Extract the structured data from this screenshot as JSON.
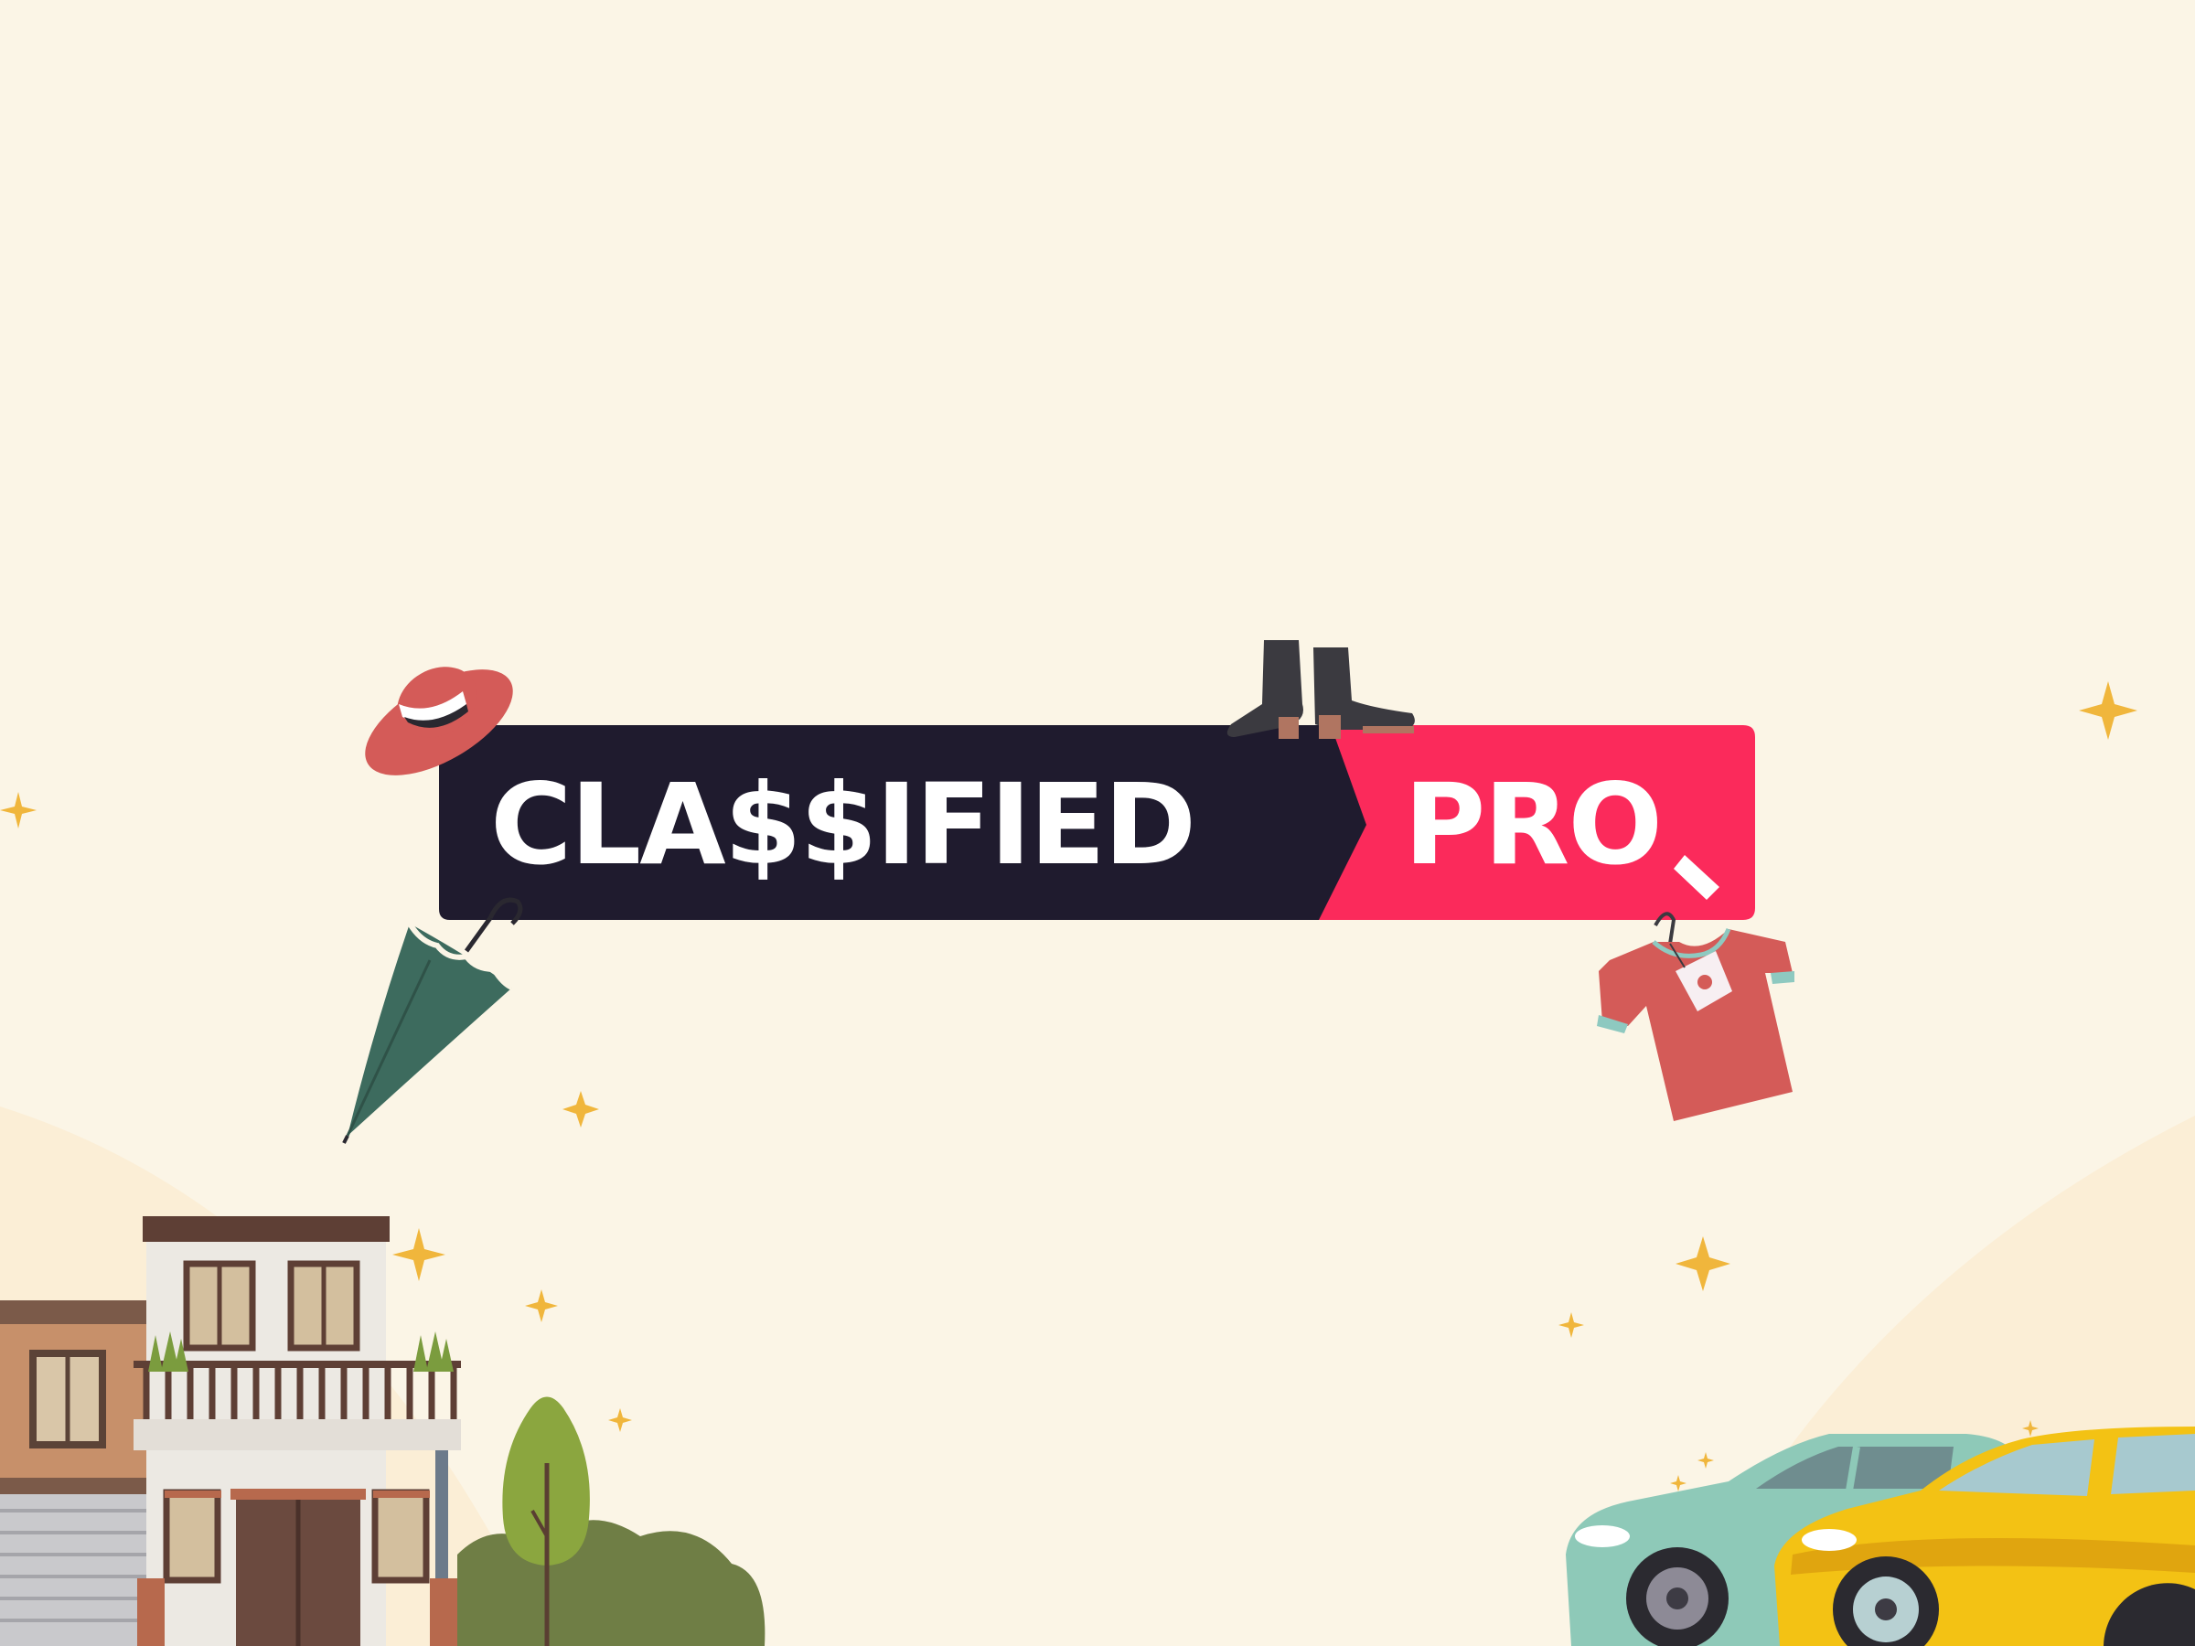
{
  "brand": {
    "name_part_1": "CLA$$IFIED",
    "name_part_2": "PRO"
  },
  "colors": {
    "background": "#fbf5e6",
    "logo_dark": "#1f1b2e",
    "logo_accent": "#fb2a5b",
    "sparkle": "#f0b63c"
  },
  "illustrations": {
    "top_items": [
      "hat-icon",
      "boots-icon"
    ],
    "side_items": [
      "umbrella-icon",
      "tshirt-icon"
    ],
    "scene": [
      "house",
      "shop",
      "tree",
      "bush",
      "cars",
      "sparkles"
    ]
  }
}
